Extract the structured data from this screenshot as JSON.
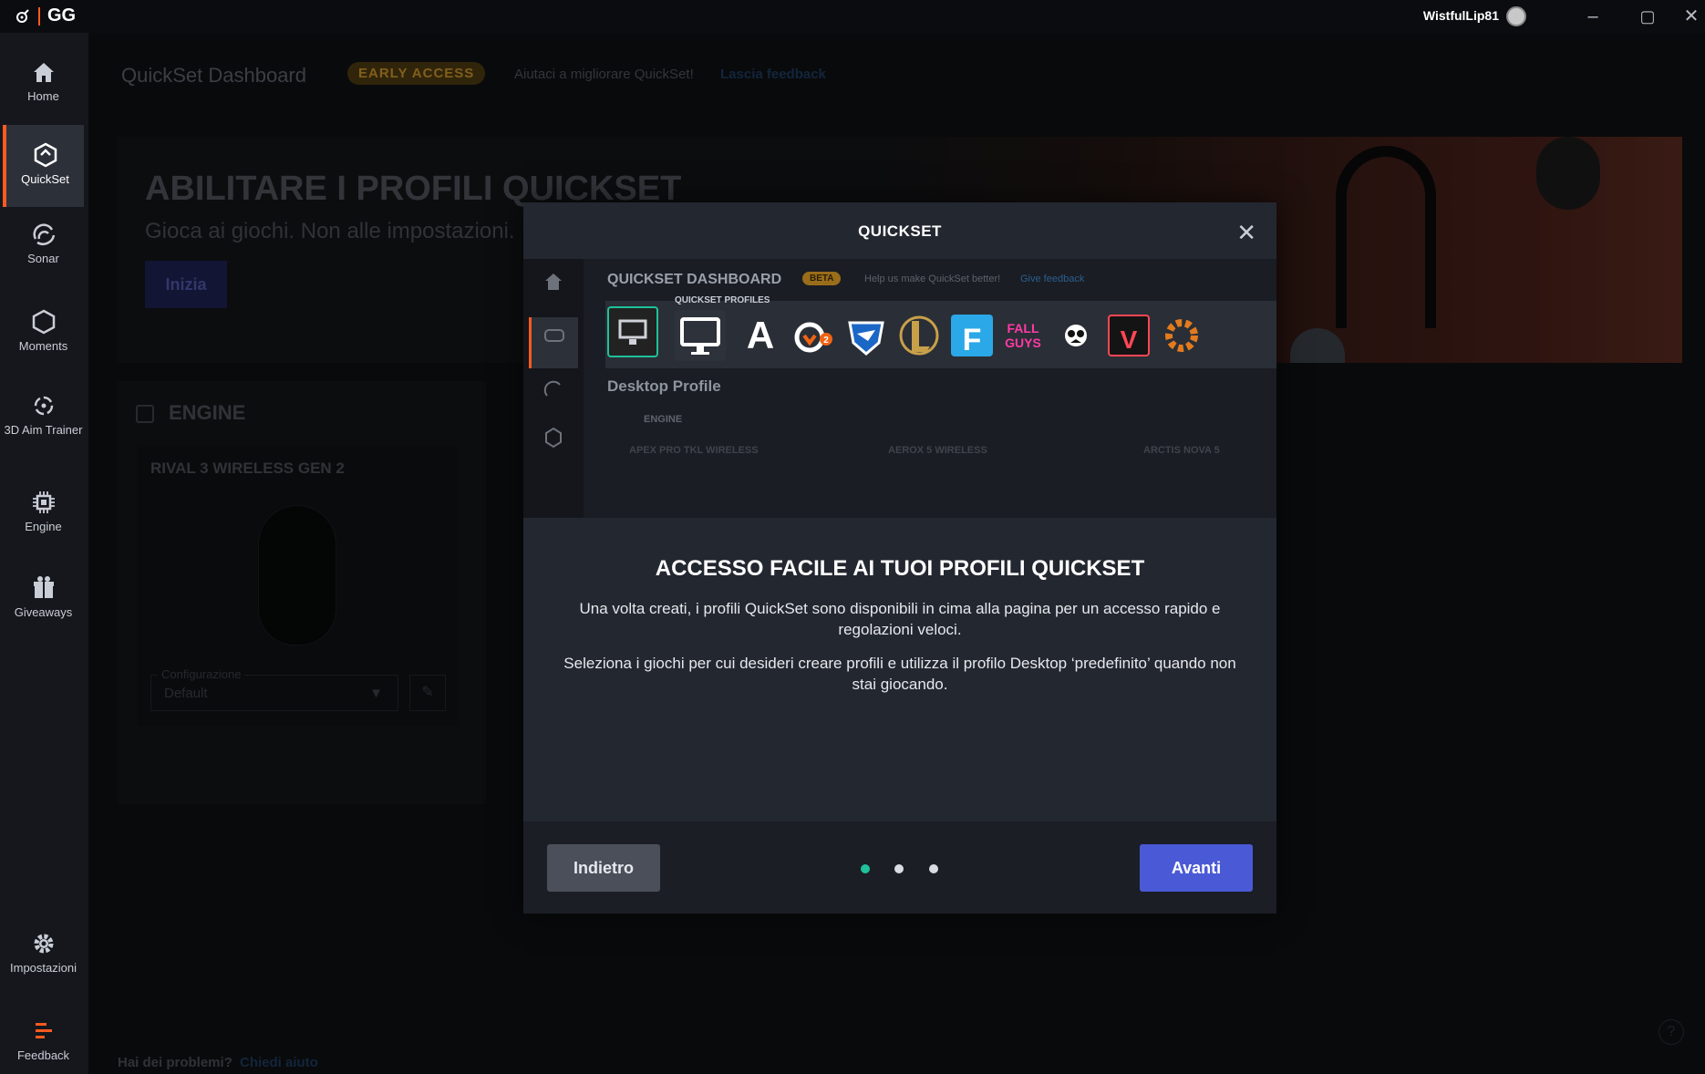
{
  "titlebar": {
    "app": "GG",
    "username": "WistfulLip81"
  },
  "sidebar": {
    "items": [
      {
        "label": "Home",
        "icon": "home-icon"
      },
      {
        "label": "QuickSet",
        "icon": "quickset-icon",
        "active": true
      },
      {
        "label": "Sonar",
        "icon": "sonar-icon"
      },
      {
        "label": "Moments",
        "icon": "moments-icon"
      },
      {
        "label": "3D Aim Trainer",
        "icon": "aim-trainer-icon"
      },
      {
        "label": "Engine",
        "icon": "engine-icon"
      },
      {
        "label": "Giveaways",
        "icon": "gift-icon"
      }
    ],
    "settings": "Impostazioni",
    "feedback": "Feedback"
  },
  "header": {
    "title": "QuickSet Dashboard",
    "badge": "EARLY ACCESS",
    "help_text": "Aiutaci a migliorare QuickSet!",
    "help_link": "Lascia feedback"
  },
  "hero": {
    "title": "ABILITARE I PROFILI QUICKSET",
    "subtitle": "Gioca ai giochi. Non alle impostazioni.",
    "button": "Inizia"
  },
  "engine": {
    "title": "ENGINE",
    "device": "RIVAL 3 WIRELESS GEN 2",
    "config_label": "Configurazione",
    "config_value": "Default"
  },
  "footer": {
    "problem_text": "Hai dei problemi?",
    "help_link": "Chiedi aiuto"
  },
  "modal": {
    "title": "QUICKSET",
    "preview": {
      "title": "QUICKSET DASHBOARD",
      "badge": "BETA",
      "help": "Help us make QuickSet better!",
      "help_link": "Give feedback",
      "profiles_label": "QUICKSET PROFILES",
      "desktop_profile": "Desktop Profile",
      "engine_label": "ENGINE",
      "devices": [
        "APEX PRO TKL WIRELESS",
        "AEROX 5 WIRELESS",
        "ARCTIS NOVA 5"
      ],
      "game_tiles": [
        "A",
        "2",
        "F",
        "FALL GUYS",
        "V"
      ]
    },
    "heading": "ACCESSO FACILE AI TUOI PROFILI QUICKSET",
    "paragraph1": "Una volta creati, i profili QuickSet sono disponibili in cima alla pagina per un accesso rapido e regolazioni veloci.",
    "paragraph2": "Seleziona i giochi per cui desideri creare profili e utilizza il profilo Desktop ‘predefinito’ quando non stai giocando.",
    "back_button": "Indietro",
    "next_button": "Avanti",
    "pagination": {
      "current": 1,
      "total": 3
    }
  },
  "colors": {
    "accent": "#ff5a1f",
    "primary_button": "#4a5ad6",
    "active_dot": "#1fc19a"
  }
}
